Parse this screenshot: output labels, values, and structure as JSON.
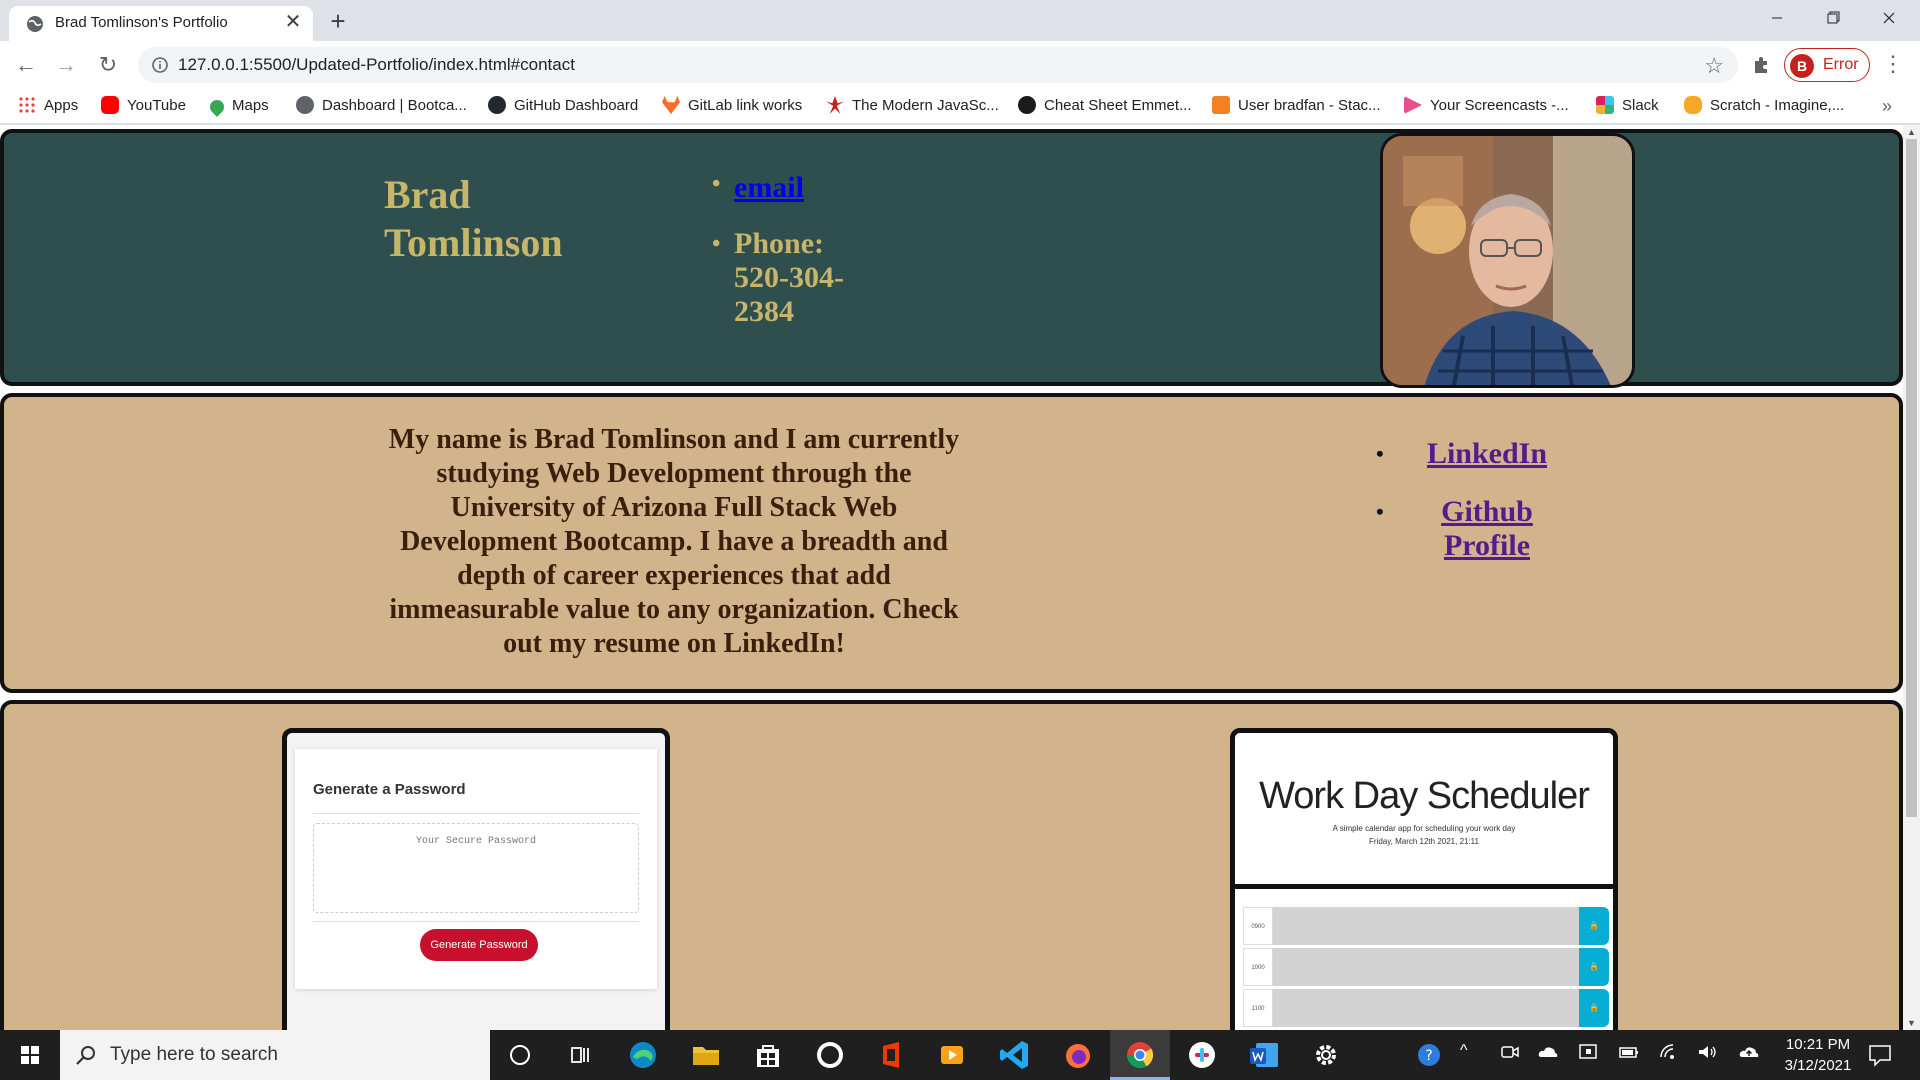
{
  "browser": {
    "tab_title": "Brad Tomlinson's Portfolio",
    "tab_close": "✕",
    "new_tab": "+",
    "url": "127.0.0.1:5500/Updated-Portfolio/index.html#contact",
    "profile_initial": "B",
    "profile_status": "Error"
  },
  "bookmarks": [
    {
      "label": "Apps",
      "color": "#4285f4"
    },
    {
      "label": "YouTube",
      "color": "#ff0000"
    },
    {
      "label": "Maps",
      "color": "#34a853"
    },
    {
      "label": "Dashboard | Bootca...",
      "color": "#5f6368"
    },
    {
      "label": "GitHub Dashboard",
      "color": "#24292e"
    },
    {
      "label": "GitLab link works",
      "color": "#fc6d26"
    },
    {
      "label": "The Modern JavaSc...",
      "color": "#c5221f"
    },
    {
      "label": "Cheat Sheet Emmet...",
      "color": "#1b1b1b"
    },
    {
      "label": "User bradfan - Stac...",
      "color": "#f48024"
    },
    {
      "label": "Your Screencasts -...",
      "color": "#e8508b"
    },
    {
      "label": "Slack",
      "color": "#4a154b"
    },
    {
      "label": "Scratch - Imagine,...",
      "color": "#f9a825"
    }
  ],
  "bookmarks_more": "»",
  "page": {
    "name": "Brad Tomlinson",
    "email_label": "email",
    "phone": "Phone: 520-304-2384",
    "about": "My name is Brad Tomlinson and I am currently studying Web Development through the University of Arizona Full Stack Web Development Bootcamp. I have a breadth and depth of career experiences that add immeasurable value to any organization. Check out my resume on LinkedIn!",
    "linkedin_label": "LinkedIn",
    "github_label": "Github Profile",
    "project1": {
      "title": "Generate a Password",
      "placeholder": "Your Secure Password",
      "button": "Generate Password"
    },
    "project2": {
      "title": "Work Day Scheduler",
      "subtitle": "A simple calendar app for scheduling your work day",
      "date": "Friday, March 12th 2021, 21:11",
      "hours": [
        "0900",
        "1000",
        "1100"
      ]
    }
  },
  "taskbar": {
    "search_placeholder": "Type here to search",
    "time": "10:21 PM",
    "date": "3/12/2021"
  },
  "colors": {
    "header_bg": "#2f4f4f",
    "section_bg": "#d2b48c",
    "gold_text": "#c7b56a",
    "about_text": "#3a1f0d"
  }
}
